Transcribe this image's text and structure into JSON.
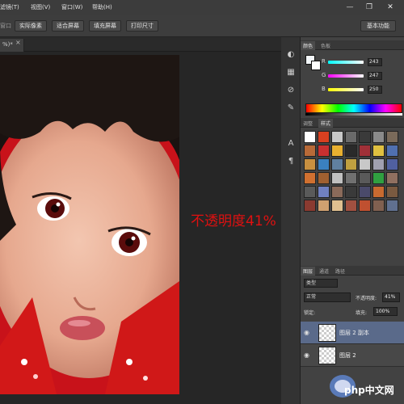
{
  "menu": {
    "items": [
      "滤镜(T)",
      "视图(V)",
      "窗口(W)",
      "帮助(H)"
    ]
  },
  "window": {
    "minimize_glyph": "—",
    "restore_glyph": "❐",
    "close_glyph": "✕"
  },
  "options": {
    "cut_label": "窗口",
    "buttons": [
      "实际像素",
      "适合屏幕",
      "填充屏幕",
      "打印尺寸"
    ],
    "workspace": "基本功能"
  },
  "document": {
    "tab_label": "%)*",
    "close_glyph": "×"
  },
  "color_panel": {
    "tabs": [
      "颜色",
      "色板"
    ],
    "sliders": [
      {
        "label": "R",
        "value": "243",
        "color": "#f30000"
      },
      {
        "label": "G",
        "value": "247",
        "color": "#00f700"
      },
      {
        "label": "B",
        "value": "250",
        "color": "#0000fa"
      }
    ],
    "foreground": "#f3f7fa"
  },
  "styles_panel": {
    "tabs": [
      "调整",
      "样式"
    ],
    "swatches": [
      "#ffffff",
      "#d84020",
      "#c8c8c8",
      "#6a6a6a",
      "#3a3a3a",
      "#8a8a8a",
      "#7a6a5a",
      "#b86a38",
      "#c83030",
      "#e8b030",
      "#2a2a2a",
      "#a03038",
      "#e0c040",
      "#5070b0",
      "#c89040",
      "#3a80c0",
      "#6080a0",
      "#c0a040",
      "#c8c8c8",
      "#a0a0b0",
      "#5060a0",
      "#d07030",
      "#a06030",
      "#c0c0c0",
      "#707070",
      "#5a5a5a",
      "#30a040",
      "#907060",
      "#5a5a5a",
      "#7080c0",
      "#8a6a5a",
      "#3a3a3a",
      "#4a4a6a",
      "#c86a30",
      "#7a5a40",
      "#8a3a30",
      "#d0a070",
      "#e0c090",
      "#a05040",
      "#c05030",
      "#806050",
      "#607090"
    ]
  },
  "layers_panel": {
    "tabs": [
      "图层",
      "通道",
      "路径"
    ],
    "kind": "类型",
    "blend_mode": "正常",
    "opacity_label": "不透明度:",
    "opacity_value": "41%",
    "lock_label": "锁定:",
    "fill_label": "填充:",
    "fill_value": "100%",
    "layers": [
      {
        "name": "图层 2 副本",
        "selected": true
      },
      {
        "name": "图层 2",
        "selected": false
      }
    ]
  },
  "annotation": {
    "text": "不透明度41%"
  },
  "watermark": {
    "text": "php中文网"
  },
  "icons": {
    "color_panel": "color-palette-icon",
    "swatches": "swatches-icon",
    "adjust": "adjust-icon",
    "text": "paragraph-icon",
    "styles": "styles-icon",
    "eye": "eye-icon"
  }
}
